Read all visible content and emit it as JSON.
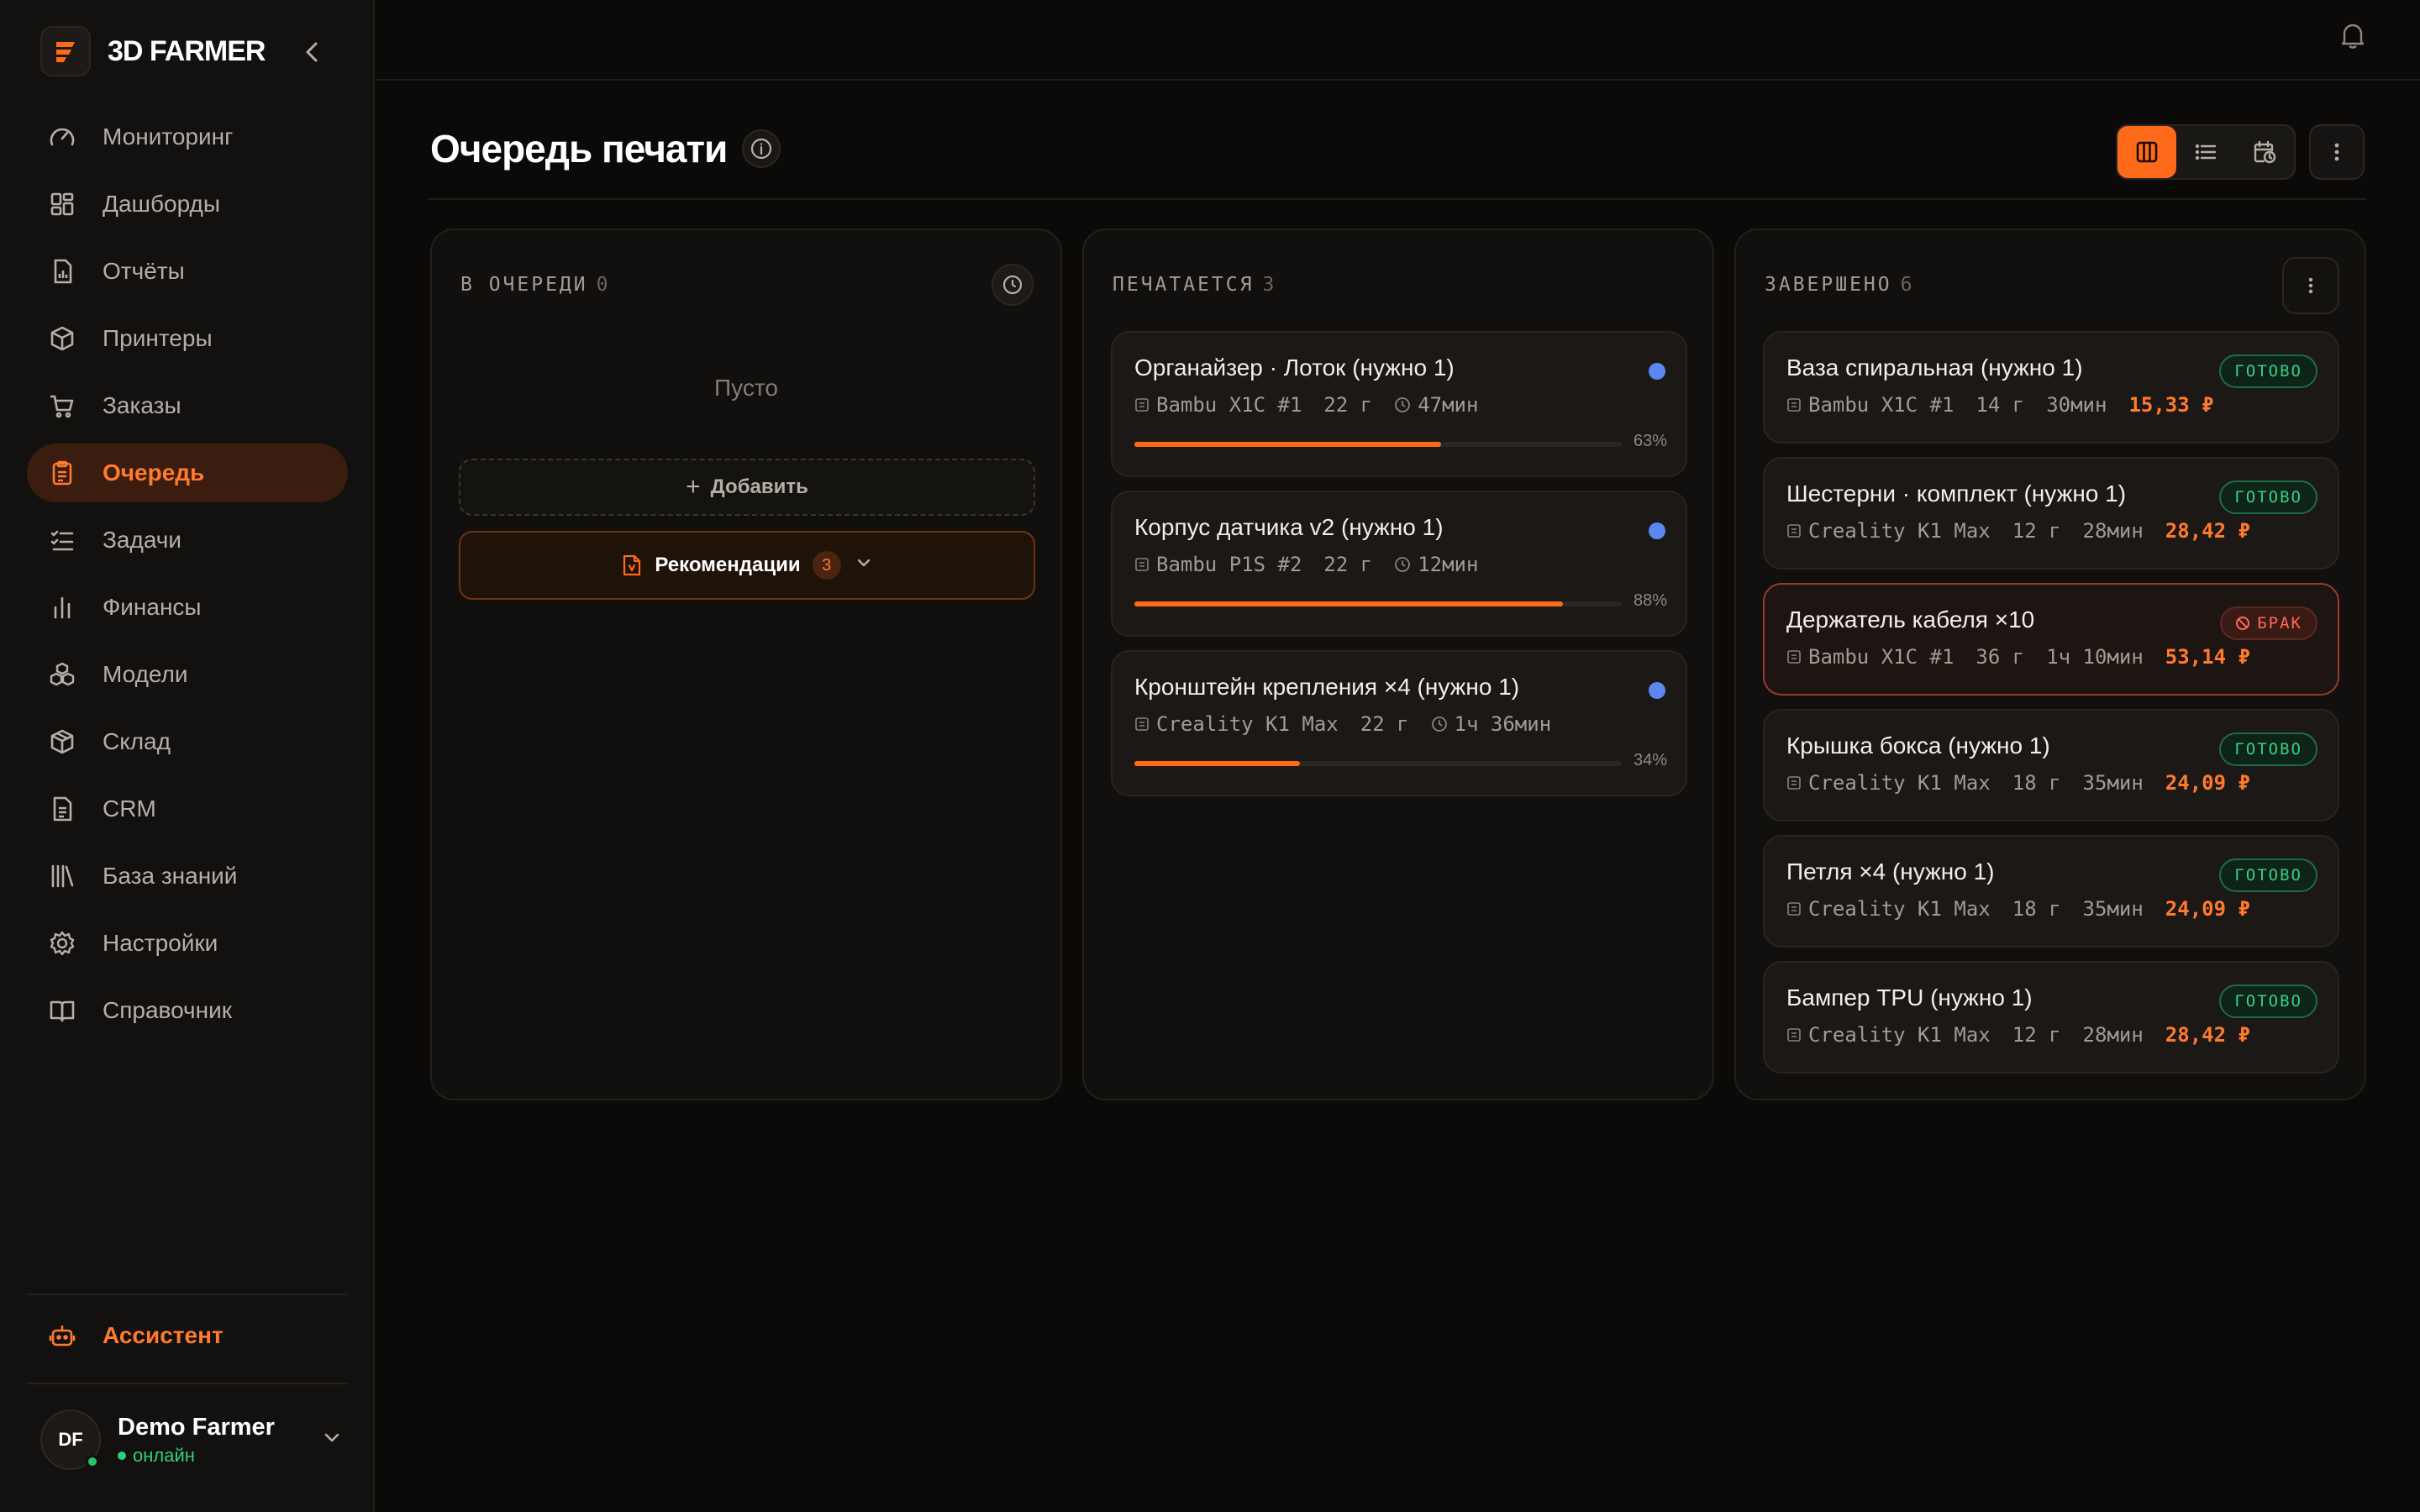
{
  "app": {
    "name": "3D FARMER"
  },
  "sidebar": {
    "items": [
      {
        "label": "Мониторинг",
        "icon": "gauge-icon"
      },
      {
        "label": "Дашборды",
        "icon": "dashboard-icon"
      },
      {
        "label": "Отчёты",
        "icon": "report-icon"
      },
      {
        "label": "Принтеры",
        "icon": "cube-icon"
      },
      {
        "label": "Заказы",
        "icon": "cart-icon"
      },
      {
        "label": "Очередь",
        "icon": "clipboard-icon",
        "active": true
      },
      {
        "label": "Задачи",
        "icon": "tasks-icon"
      },
      {
        "label": "Финансы",
        "icon": "bar-chart-icon"
      },
      {
        "label": "Модели",
        "icon": "models-icon"
      },
      {
        "label": "Склад",
        "icon": "warehouse-box-icon"
      },
      {
        "label": "CRM",
        "icon": "document-icon"
      },
      {
        "label": "База знаний",
        "icon": "library-icon"
      },
      {
        "label": "Настройки",
        "icon": "gear-icon"
      },
      {
        "label": "Справочник",
        "icon": "book-icon"
      }
    ],
    "assistant": "Ассистент",
    "user": {
      "initials": "DF",
      "name": "Demo Farmer",
      "status": "онлайн"
    }
  },
  "page": {
    "title": "Очередь печати"
  },
  "columns": {
    "queued": {
      "title": "В ОЧЕРЕДИ",
      "count": "0",
      "empty": "Пусто",
      "add": "Добавить",
      "recommendations": "Рекомендации",
      "rec_count": "3"
    },
    "printing": {
      "title": "ПЕЧАТАЕТСЯ",
      "count": "3",
      "cards": [
        {
          "title": "Органайзер · Лоток (нужно 1)",
          "printer": "Bambu X1C #1",
          "weight": "22 г",
          "time": "47мин",
          "progress": 63,
          "progress_label": "63%"
        },
        {
          "title": "Корпус датчика v2 (нужно 1)",
          "printer": "Bambu P1S #2",
          "weight": "22 г",
          "time": "12мин",
          "progress": 88,
          "progress_label": "88%"
        },
        {
          "title": "Кронштейн крепления ×4 (нужно 1)",
          "printer": "Creality K1 Max",
          "weight": "22 г",
          "time": "1ч 36мин",
          "progress": 34,
          "progress_label": "34%"
        }
      ]
    },
    "done": {
      "title": "ЗАВЕРШЕНО",
      "count": "6",
      "cards": [
        {
          "title": "Ваза спиральная (нужно 1)",
          "printer": "Bambu X1C #1",
          "weight": "14 г",
          "time": "30мин",
          "price": "15,33 ₽",
          "status": "ГОТОВО",
          "bad": false
        },
        {
          "title": "Шестерни · комплект (нужно 1)",
          "printer": "Creality K1 Max",
          "weight": "12 г",
          "time": "28мин",
          "price": "28,42 ₽",
          "status": "ГОТОВО",
          "bad": false
        },
        {
          "title": "Держатель кабеля ×10",
          "printer": "Bambu X1C #1",
          "weight": "36 г",
          "time": "1ч 10мин",
          "price": "53,14 ₽",
          "status": "БРАК",
          "bad": true
        },
        {
          "title": "Крышка бокса (нужно 1)",
          "printer": "Creality K1 Max",
          "weight": "18 г",
          "time": "35мин",
          "price": "24,09 ₽",
          "status": "ГОТОВО",
          "bad": false
        },
        {
          "title": "Петля ×4 (нужно 1)",
          "printer": "Creality K1 Max",
          "weight": "18 г",
          "time": "35мин",
          "price": "24,09 ₽",
          "status": "ГОТОВО",
          "bad": false
        },
        {
          "title": "Бампер TPU (нужно 1)",
          "printer": "Creality K1 Max",
          "weight": "12 г",
          "time": "28мин",
          "price": "28,42 ₽",
          "status": "ГОТОВО",
          "bad": false
        }
      ]
    }
  },
  "colors": {
    "accent": "#ff6a1a",
    "success": "#36d183",
    "danger": "#ff6a5a",
    "progress_dot": "#5b87f0"
  }
}
